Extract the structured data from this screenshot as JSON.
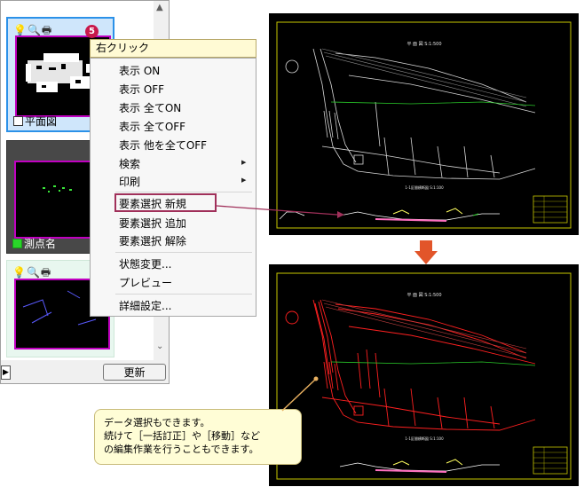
{
  "left_panel": {
    "thumbnails": [
      {
        "caption": "平面図",
        "icons": [
          "bulb-icon",
          "magnifier-icon",
          "printer-icon"
        ],
        "checked": false
      },
      {
        "caption": "測点名",
        "checked": true,
        "check_color": "#29d629"
      },
      {
        "caption": "",
        "icons": [
          "bulb-icon",
          "magnifier-icon",
          "printer-icon"
        ]
      }
    ],
    "update_button": "更新"
  },
  "context_menu": {
    "step": "5",
    "header": "右クリック",
    "items": [
      {
        "label": "表示 ON"
      },
      {
        "label": "表示 OFF"
      },
      {
        "label": "表示 全てON"
      },
      {
        "label": "表示 全てOFF"
      },
      {
        "label": "表示 他を全てOFF"
      },
      {
        "label": "検索",
        "submenu": true
      },
      {
        "label": "印刷",
        "submenu": true
      },
      {
        "label": "要素選択 新規",
        "highlighted": true
      },
      {
        "label": "要素選択 追加"
      },
      {
        "label": "要素選択 解除"
      },
      {
        "label": "状態変更..."
      },
      {
        "label": "プレビュー"
      },
      {
        "label": "詳細設定..."
      }
    ]
  },
  "drawing_top": {
    "title": "平 面 図  S:1:500",
    "section_title": "1-1区間横断図  S:1:100"
  },
  "drawing_bottom": {
    "title": "平 面 図  S:1:500",
    "section_title": "1-1区間横断図  S:1:100"
  },
  "callout": {
    "lines": [
      "データ選択もできます。",
      "続けて［一括訂正］や［移動］など",
      "の編集作業を行うこともできます。"
    ]
  },
  "colors": {
    "accent_arrow": "#e2552a",
    "highlight_border": "#a0305a",
    "badge": "#c8194b",
    "selected_red": "#ff2020",
    "thumb_frame": "#c000c0"
  }
}
